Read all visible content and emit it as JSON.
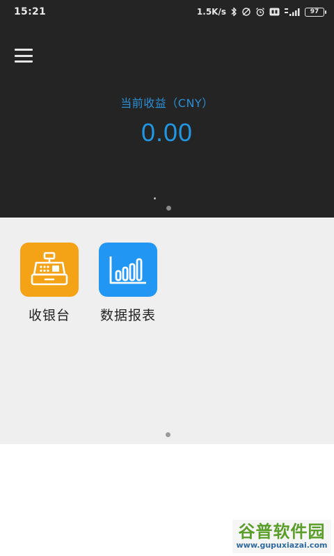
{
  "status_bar": {
    "time": "15:21",
    "net_speed": "1.5K/s",
    "battery_level": "97"
  },
  "header": {
    "earnings_label": "当前收益（CNY）",
    "earnings_value": "0.00"
  },
  "apps": [
    {
      "label": "收银台",
      "icon": "cash-register-icon",
      "color": "#F5A316"
    },
    {
      "label": "数据报表",
      "icon": "bar-chart-icon",
      "color": "#2196F3"
    }
  ],
  "watermark": {
    "title": "谷普软件园",
    "url": "www.gupuxiazai.com"
  },
  "colors": {
    "header_bg": "#242424",
    "accent": "#2196E3",
    "grid_bg": "#EFEFEF"
  }
}
